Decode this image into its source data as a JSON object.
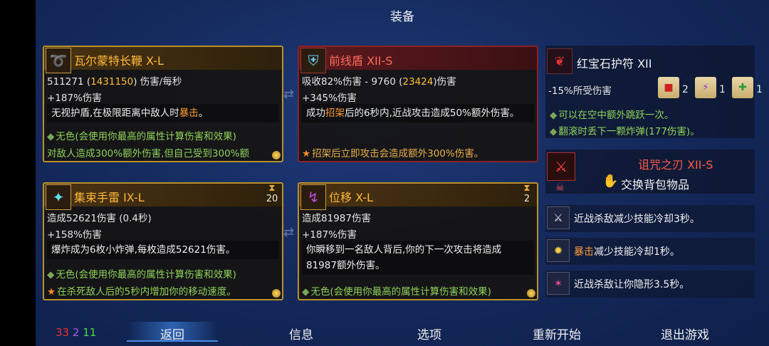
{
  "screen_title": "装备",
  "weapon1": {
    "name": "瓦尔蒙特长鞭 X-L",
    "dps_a": "511271",
    "dps_b": "1431150",
    "dps_unit": "伤害/每秒",
    "bonus": "+187%伤害",
    "desc_a": "无视护盾,在极限距离中敌人时",
    "desc_hl": "暴击",
    "desc_b": "。",
    "color_line": "无色(会使用你最高的属性计算伤害和效果)",
    "curse_line": "对敌人造成300%额外伤害,但自己受到300%额"
  },
  "shield": {
    "name": "前线盾 XII-S",
    "block_a": "吸收82%伤害 - 9760",
    "block_b": "23424",
    "block_c": "伤害",
    "bonus": "+345%伤害",
    "desc_a": "成功",
    "desc_hl": "招架",
    "desc_b": "后的6秒内,近战攻击造成50%额外伤害。",
    "extra": "招架后立即攻击会造成额外300%伤害。"
  },
  "skill1": {
    "name": "集束手雷 IX-L",
    "cooldown": "20",
    "dmg": "造成52621伤害 (0.4秒)",
    "bonus": "+158%伤害",
    "desc": "爆炸成为6枚小炸弹,每枚造成52621伤害。",
    "color_line": "无色(会使用你最高的属性计算伤害和效果)",
    "extra": "在杀死敌人后的5秒内增加你的移动速度。"
  },
  "skill2": {
    "name": "位移 X-L",
    "cooldown": "2",
    "dmg": "造成81987伤害",
    "bonus": "+187%伤害",
    "desc": "你瞬移到一名敌人背后,你的下一次攻击将造成81987额外伤害。",
    "color_line": "无色(会使用你最高的属性计算伤害和效果)"
  },
  "amulet": {
    "name": "红宝石护符 XII",
    "stat": "-15%所受伤害",
    "scroll_counts": [
      "2",
      "1",
      "1"
    ],
    "lines": [
      "可以在空中额外跳跃一次。",
      "翻滚时丢下一颗炸弹(177伤害)。"
    ]
  },
  "cursed": {
    "name": "诅咒之刃 XII-S",
    "swap": "交换背包物品"
  },
  "mutations": [
    {
      "a": "近战杀敌减少技能冷却3秒。",
      "hl": "",
      "b": ""
    },
    {
      "a": "",
      "hl": "暴击",
      "b": "减少技能冷却1秒。"
    },
    {
      "a": "近战杀敌让你隐形3.5秒。",
      "hl": "",
      "b": ""
    }
  ],
  "scroll_stats": {
    "brutality": "33",
    "tactics": "2",
    "survival": "11"
  },
  "nav": {
    "back": "返回",
    "info": "信息",
    "options": "选项",
    "restart": "重新开始",
    "quit": "退出游戏"
  },
  "colors": {
    "legendary_border": "#b8902c",
    "cursed_border": "#8a2228",
    "accent": "#ffb83a"
  }
}
